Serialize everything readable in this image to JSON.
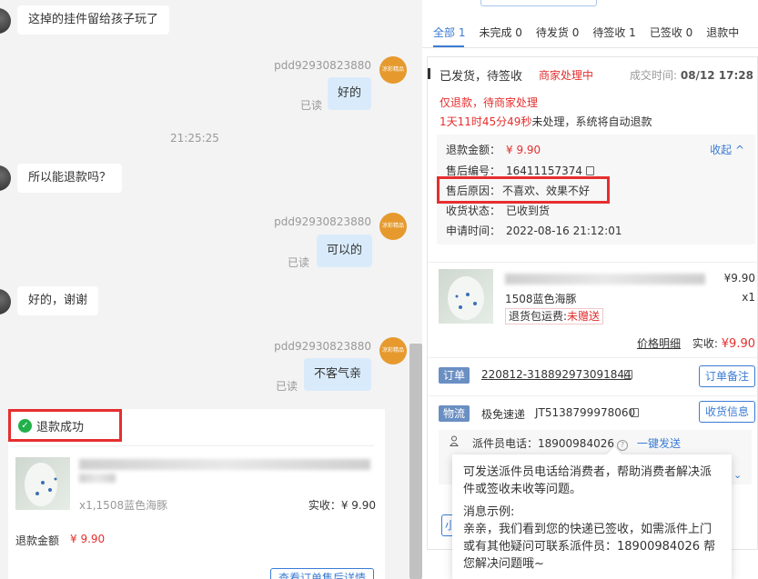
{
  "chat": {
    "messages": [
      {
        "side": "left",
        "text": "这掉的挂件留给孩子玩了"
      },
      {
        "side": "right",
        "user": "pdd92930823880",
        "text": "好的",
        "read": "已读"
      },
      {
        "side": "time",
        "text": "21:25:25"
      },
      {
        "side": "left",
        "text": "所以能退款吗？"
      },
      {
        "side": "right",
        "user": "pdd92930823880",
        "text": "可以的",
        "read": "已读"
      },
      {
        "side": "left",
        "text": "好的，谢谢"
      },
      {
        "side": "right",
        "user": "pdd92930823880",
        "text": "不客气亲",
        "read": "已读"
      }
    ],
    "avatar_text": "凉彩精品",
    "refund_card": {
      "title": "退款成功",
      "spec": "x1,1508蓝色海豚",
      "paid": "实收：¥ 9.90",
      "amount_label": "退款金额",
      "amount": "¥ 9.90",
      "button": "查看订单售后详情"
    }
  },
  "order_panel": {
    "tabs": [
      "全部 1",
      "未完成 0",
      "待发货 0",
      "待签收 1",
      "已签收 0",
      "退款中"
    ],
    "status": "已发货，待签收",
    "merchant_status": "商家处理中",
    "deal_time_label": "成交时间:",
    "deal_time": "08/12 17:28",
    "refund_type": "仅退款，待商家处理",
    "countdown": "1天11时45分49秒",
    "countdown_suffix": "未处理，系统将自动退款",
    "detail": {
      "amount_label": "退款金额：",
      "amount": "¥ 9.90",
      "collapse": "收起 ^",
      "aftersale_no_label": "售后编号：",
      "aftersale_no": "16411157374",
      "reason_label": "售后原因：",
      "reason": "不喜欢、效果不好",
      "receive_label": "收货状态：",
      "receive": "已收到货",
      "apply_label": "申请时间：",
      "apply_time": "2022-08-16 21:12:01"
    },
    "product": {
      "price": "¥9.90",
      "spec": "1508蓝色海豚",
      "qty": "x1",
      "ship_label": "退货包运费:",
      "ship_value": "未赠送",
      "breakdown": "价格明细",
      "paid_label": "实收:",
      "paid": "¥9.90"
    },
    "order": {
      "tag": "订单",
      "number": "220812-318892973091844",
      "button": "订单备注"
    },
    "logistics": {
      "tag": "物流",
      "company": "极免速递",
      "tracking": "JT5138799978060",
      "button": "收货信息",
      "courier_phone": "派件员电话：18900984026",
      "send": "一键发送"
    },
    "bottom_button": "小"
  },
  "tooltip": {
    "desc": "可发送派件员电话给消费者，帮助消费者解决派件或签收未收等问题。",
    "example_label": "消息示例:",
    "example": "亲亲，我们看到您的快递已签收，如需派件上门或有其他疑问可联系派件员：18900984026 帮您解决问题哦~"
  },
  "colors": {
    "accent": "#3a7bd5",
    "alert": "#e62e2e",
    "highlight_box": "#e62e2e",
    "chat_bubble_self": "#d9ebfb"
  }
}
